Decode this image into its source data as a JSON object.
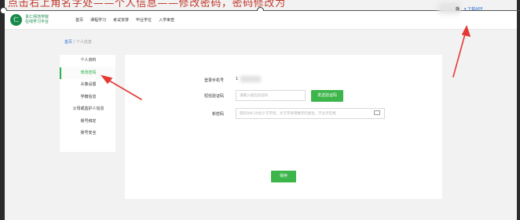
{
  "instruction": "点击右上角名字处——个人信息——修改密码，密码修改为",
  "header": {
    "logo_char": "仁",
    "logo_line1": "贵仁师范学院",
    "logo_line2": "在线学习平台",
    "nav": [
      "首页",
      "课程学习",
      "考试安排",
      "毕业学位",
      "入学审查"
    ],
    "user_suffix": "静",
    "download_app": "下载APP"
  },
  "breadcrumb": {
    "home": "首页",
    "sep": "/",
    "current": "个人信息"
  },
  "sidebar": {
    "items": [
      "个人资料",
      "修改密码",
      "头像设置",
      "学籍信息",
      "父母或监护人信息",
      "账号绑定",
      "账号安全"
    ],
    "active_index": 1
  },
  "form": {
    "phone_label": "登录手机号",
    "phone_value": "1",
    "code_label": "短信验证码",
    "code_placeholder": "请输入短信验证码",
    "send_code_button": "发送验证码",
    "password_label": "新密码",
    "password_placeholder": "密码为8-20位小写字母、大写字母和数字的组合，不允许空格",
    "save_button": "保存"
  },
  "colors": {
    "accent_green": "#3cb54a",
    "link_blue": "#2b6fd6",
    "annotation_red": "#e53935"
  }
}
